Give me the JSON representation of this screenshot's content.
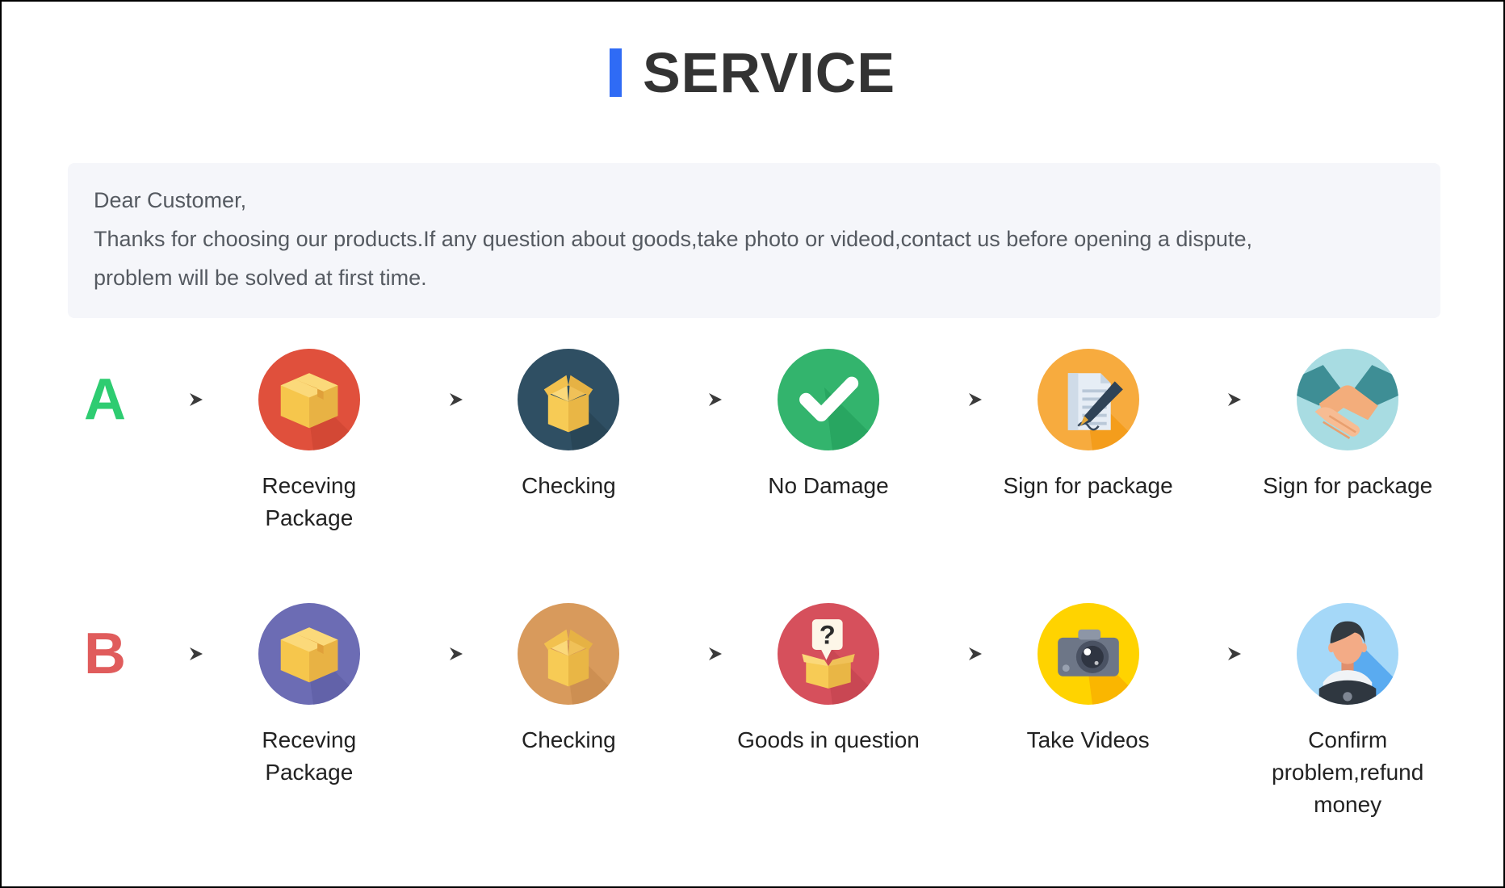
{
  "page": {
    "title": "SERVICE",
    "accent_color": "#2f6bf5",
    "title_color": "#333333",
    "background": "#ffffff"
  },
  "notice": {
    "background": "#f5f6fa",
    "text_color": "#555a61",
    "lines": [
      "Dear Customer,",
      "Thanks for choosing our products.If any question about goods,take photo or videod,contact us before opening a dispute,",
      "problem will be solved at first time."
    ]
  },
  "flows": [
    {
      "badge": "A",
      "badge_color": "#2ecc71",
      "arrow_icon": "arrow-right-icon",
      "steps": [
        {
          "label": "Receving Package",
          "icon": "package-box-icon",
          "circle_color": "#e0503c",
          "shadow_color": "#c9422f"
        },
        {
          "label": "Checking",
          "icon": "open-box-icon",
          "circle_color": "#2f4f63",
          "shadow_color": "#25404f"
        },
        {
          "label": "No Damage",
          "icon": "check-mark-icon",
          "circle_color": "#33b46d",
          "shadow_color": "#1f9a57"
        },
        {
          "label": "Sign for package",
          "icon": "document-pen-icon",
          "circle_color": "#f7ab3e",
          "shadow_color": "#f39200"
        },
        {
          "label": "Sign for package",
          "icon": "handshake-icon",
          "circle_color": "#a8dce2",
          "shadow_color": "#3e8e95"
        }
      ]
    },
    {
      "badge": "B",
      "badge_color": "#e05c5c",
      "arrow_icon": "arrow-right-icon",
      "steps": [
        {
          "label": "Receving Package",
          "icon": "package-box-icon",
          "circle_color": "#6c6cb4",
          "shadow_color": "#5b5ba0"
        },
        {
          "label": "Checking",
          "icon": "open-box-icon",
          "circle_color": "#d89a5c",
          "shadow_color": "#c4874a"
        },
        {
          "label": "Goods in question",
          "icon": "question-box-icon",
          "circle_color": "#d6505c",
          "shadow_color": "#c03f4c"
        },
        {
          "label": "Take Videos",
          "icon": "camera-icon",
          "circle_color": "#ffd300",
          "shadow_color": "#f59f00"
        },
        {
          "label": "Confirm problem,refund money",
          "icon": "support-person-icon",
          "circle_color": "#a5d8f8",
          "shadow_color": "#5aabf0"
        }
      ]
    }
  ]
}
